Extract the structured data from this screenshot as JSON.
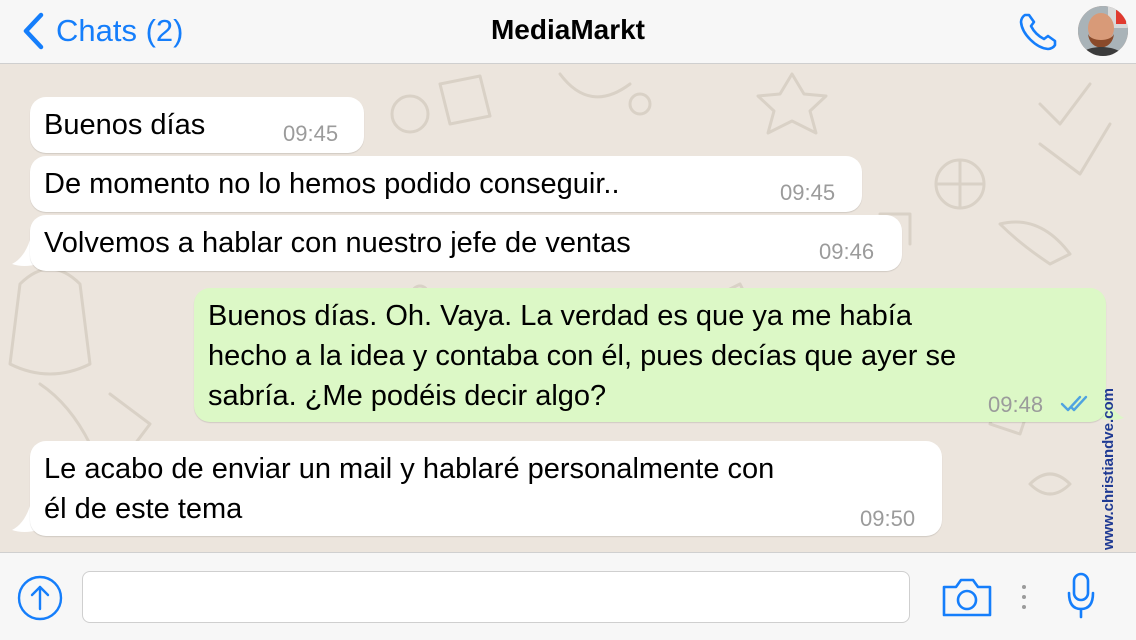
{
  "header": {
    "back_label": "Chats (2)",
    "title": "MediaMarkt",
    "icons": [
      "chevron-left-icon",
      "phone-icon",
      "avatar"
    ]
  },
  "messages": [
    {
      "direction": "incoming",
      "lines": [
        "Buenos días"
      ],
      "time": "09:45"
    },
    {
      "direction": "incoming",
      "lines": [
        "De momento no lo hemos podido conseguir.."
      ],
      "time": "09:45"
    },
    {
      "direction": "incoming",
      "lines": [
        "Volvemos a hablar con nuestro jefe de ventas"
      ],
      "time": "09:46"
    },
    {
      "direction": "outgoing",
      "lines": [
        "Buenos días. Oh. Vaya. La verdad es que ya me había",
        "hecho a la idea y contaba con él, pues decías que ayer se",
        "sabría. ¿Me podéis decir algo?"
      ],
      "time": "09:48",
      "status": "read"
    },
    {
      "direction": "incoming",
      "lines": [
        "Le acabo de enviar un mail y hablaré personalmente con",
        "él de este tema"
      ],
      "time": "09:50"
    }
  ],
  "watermark": "www.christiandve.com",
  "composer": {
    "input_value": "",
    "icons": [
      "upload-arrow-icon",
      "camera-icon",
      "microphone-icon"
    ]
  },
  "colors": {
    "accent": "#157efb",
    "incoming_bubble": "#ffffff",
    "outgoing_bubble": "#dcf8c6",
    "wallpaper": "#ece5dd",
    "read_ticks": "#4fa3e0",
    "timestamp": "#9b9b9b"
  }
}
